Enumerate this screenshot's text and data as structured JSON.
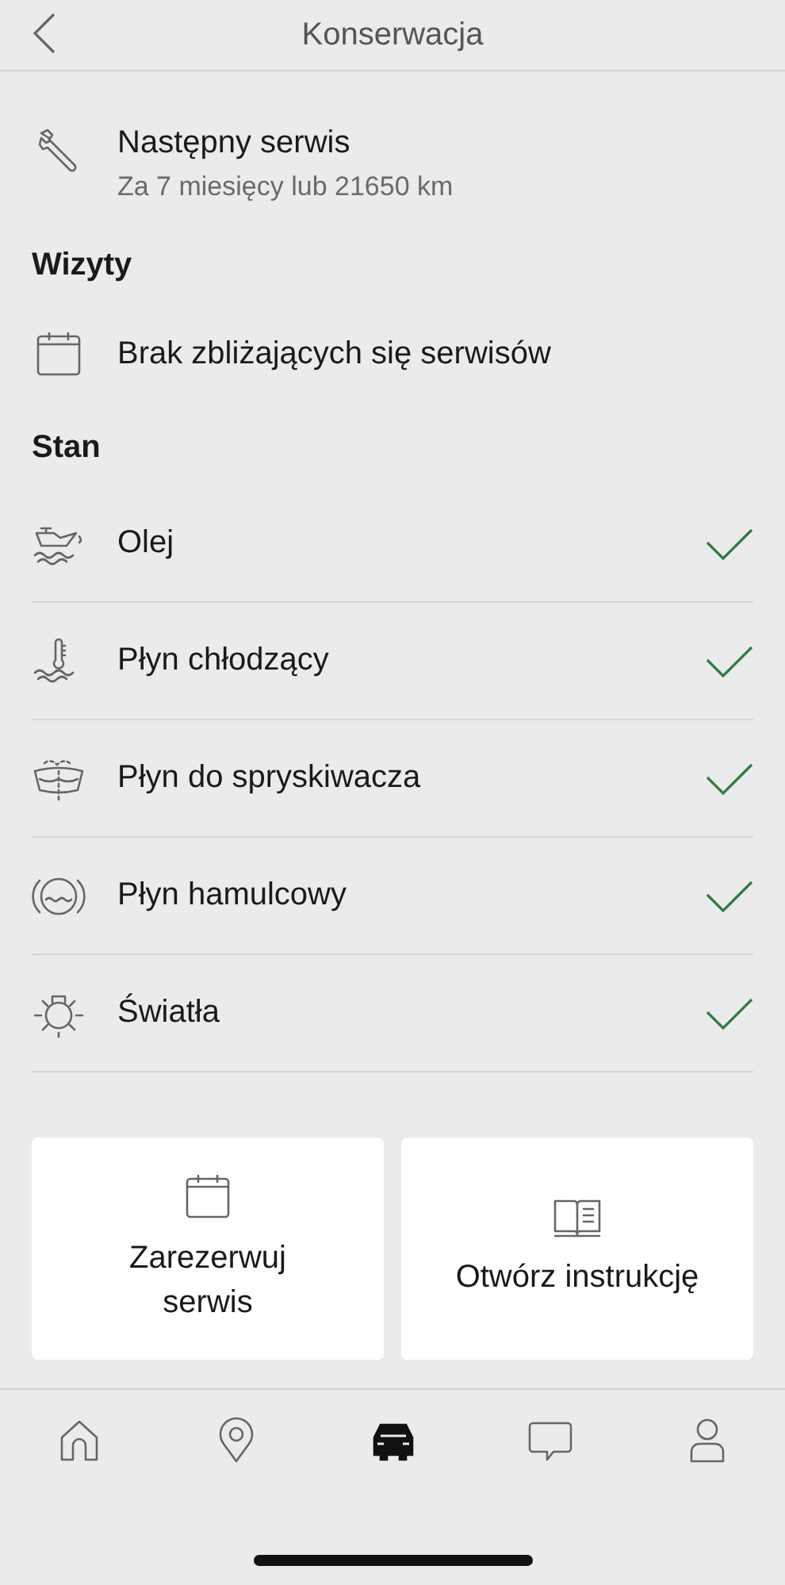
{
  "header": {
    "title": "Konserwacja"
  },
  "next_service": {
    "title": "Następny serwis",
    "subtitle": "Za 7 miesięcy lub 21650 km"
  },
  "visits": {
    "heading": "Wizyty",
    "text": "Brak zbliżających się serwisów"
  },
  "status": {
    "heading": "Stan",
    "items": [
      {
        "label": "Olej",
        "ok": true
      },
      {
        "label": "Płyn chłodzący",
        "ok": true
      },
      {
        "label": "Płyn do spryskiwacza",
        "ok": true
      },
      {
        "label": "Płyn hamulcowy",
        "ok": true
      },
      {
        "label": "Światła",
        "ok": true
      }
    ]
  },
  "actions": [
    {
      "label": "Zarezerwuj serwis"
    },
    {
      "label": "Otwórz instrukcję"
    }
  ],
  "nav": [
    {
      "selected": false
    },
    {
      "selected": false
    },
    {
      "selected": true
    },
    {
      "selected": false
    },
    {
      "selected": false
    }
  ]
}
